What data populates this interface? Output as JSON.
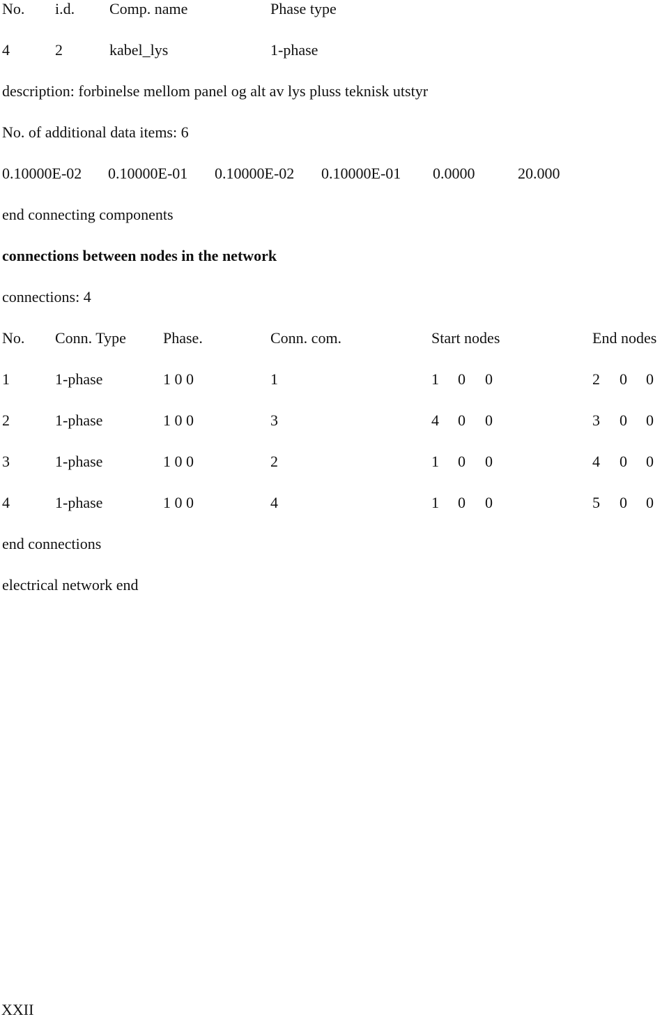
{
  "component_table": {
    "headers": [
      "No.",
      "i.d.",
      "Comp. name",
      "Phase type"
    ],
    "row": [
      "4",
      "2",
      "kabel_lys",
      "1-phase"
    ]
  },
  "description": "description: forbinelse mellom panel og alt av lys pluss teknisk utstyr",
  "additional_items": "No. of additional data items: 6",
  "data_values": [
    "0.10000E-02",
    "0.10000E-01",
    "0.10000E-02",
    "0.10000E-01",
    "0.0000",
    "20.000"
  ],
  "end_components": "end connecting components",
  "section_title": "connections between nodes in the network",
  "connections_count": "connections: 4",
  "connections_table": {
    "headers": [
      "No.",
      "Conn. Type",
      "Phase.",
      "Conn. com.",
      "Start nodes",
      "End nodes"
    ],
    "rows": [
      {
        "no": "1",
        "type": "1-phase",
        "phase": "1 0 0",
        "com": "1",
        "start": [
          "1",
          "0",
          "0"
        ],
        "end": [
          "2",
          "0",
          "0"
        ]
      },
      {
        "no": "2",
        "type": "1-phase",
        "phase": "1 0 0",
        "com": "3",
        "start": [
          "4",
          "0",
          "0"
        ],
        "end": [
          "3",
          "0",
          "0"
        ]
      },
      {
        "no": "3",
        "type": "1-phase",
        "phase": "1 0 0",
        "com": "2",
        "start": [
          "1",
          "0",
          "0"
        ],
        "end": [
          "4",
          "0",
          "0"
        ]
      },
      {
        "no": "4",
        "type": "1-phase",
        "phase": "1 0 0",
        "com": "4",
        "start": [
          "1",
          "0",
          "0"
        ],
        "end": [
          "5",
          "0",
          "0"
        ]
      }
    ]
  },
  "end_connections": "end connections",
  "network_end": "electrical network end",
  "page_number": "XXII"
}
